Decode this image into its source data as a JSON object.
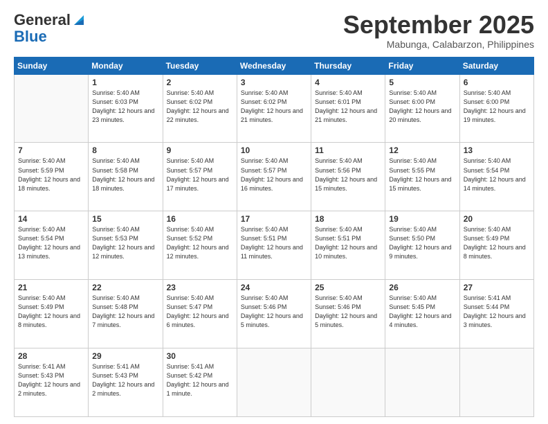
{
  "header": {
    "logo_general": "General",
    "logo_blue": "Blue",
    "month_title": "September 2025",
    "location": "Mabunga, Calabarzon, Philippines"
  },
  "days": [
    "Sunday",
    "Monday",
    "Tuesday",
    "Wednesday",
    "Thursday",
    "Friday",
    "Saturday"
  ],
  "weeks": [
    [
      {
        "day": "",
        "sunrise": "",
        "sunset": "",
        "daylight": ""
      },
      {
        "day": "1",
        "sunrise": "Sunrise: 5:40 AM",
        "sunset": "Sunset: 6:03 PM",
        "daylight": "Daylight: 12 hours and 23 minutes."
      },
      {
        "day": "2",
        "sunrise": "Sunrise: 5:40 AM",
        "sunset": "Sunset: 6:02 PM",
        "daylight": "Daylight: 12 hours and 22 minutes."
      },
      {
        "day": "3",
        "sunrise": "Sunrise: 5:40 AM",
        "sunset": "Sunset: 6:02 PM",
        "daylight": "Daylight: 12 hours and 21 minutes."
      },
      {
        "day": "4",
        "sunrise": "Sunrise: 5:40 AM",
        "sunset": "Sunset: 6:01 PM",
        "daylight": "Daylight: 12 hours and 21 minutes."
      },
      {
        "day": "5",
        "sunrise": "Sunrise: 5:40 AM",
        "sunset": "Sunset: 6:00 PM",
        "daylight": "Daylight: 12 hours and 20 minutes."
      },
      {
        "day": "6",
        "sunrise": "Sunrise: 5:40 AM",
        "sunset": "Sunset: 6:00 PM",
        "daylight": "Daylight: 12 hours and 19 minutes."
      }
    ],
    [
      {
        "day": "7",
        "sunrise": "Sunrise: 5:40 AM",
        "sunset": "Sunset: 5:59 PM",
        "daylight": "Daylight: 12 hours and 18 minutes."
      },
      {
        "day": "8",
        "sunrise": "Sunrise: 5:40 AM",
        "sunset": "Sunset: 5:58 PM",
        "daylight": "Daylight: 12 hours and 18 minutes."
      },
      {
        "day": "9",
        "sunrise": "Sunrise: 5:40 AM",
        "sunset": "Sunset: 5:57 PM",
        "daylight": "Daylight: 12 hours and 17 minutes."
      },
      {
        "day": "10",
        "sunrise": "Sunrise: 5:40 AM",
        "sunset": "Sunset: 5:57 PM",
        "daylight": "Daylight: 12 hours and 16 minutes."
      },
      {
        "day": "11",
        "sunrise": "Sunrise: 5:40 AM",
        "sunset": "Sunset: 5:56 PM",
        "daylight": "Daylight: 12 hours and 15 minutes."
      },
      {
        "day": "12",
        "sunrise": "Sunrise: 5:40 AM",
        "sunset": "Sunset: 5:55 PM",
        "daylight": "Daylight: 12 hours and 15 minutes."
      },
      {
        "day": "13",
        "sunrise": "Sunrise: 5:40 AM",
        "sunset": "Sunset: 5:54 PM",
        "daylight": "Daylight: 12 hours and 14 minutes."
      }
    ],
    [
      {
        "day": "14",
        "sunrise": "Sunrise: 5:40 AM",
        "sunset": "Sunset: 5:54 PM",
        "daylight": "Daylight: 12 hours and 13 minutes."
      },
      {
        "day": "15",
        "sunrise": "Sunrise: 5:40 AM",
        "sunset": "Sunset: 5:53 PM",
        "daylight": "Daylight: 12 hours and 12 minutes."
      },
      {
        "day": "16",
        "sunrise": "Sunrise: 5:40 AM",
        "sunset": "Sunset: 5:52 PM",
        "daylight": "Daylight: 12 hours and 12 minutes."
      },
      {
        "day": "17",
        "sunrise": "Sunrise: 5:40 AM",
        "sunset": "Sunset: 5:51 PM",
        "daylight": "Daylight: 12 hours and 11 minutes."
      },
      {
        "day": "18",
        "sunrise": "Sunrise: 5:40 AM",
        "sunset": "Sunset: 5:51 PM",
        "daylight": "Daylight: 12 hours and 10 minutes."
      },
      {
        "day": "19",
        "sunrise": "Sunrise: 5:40 AM",
        "sunset": "Sunset: 5:50 PM",
        "daylight": "Daylight: 12 hours and 9 minutes."
      },
      {
        "day": "20",
        "sunrise": "Sunrise: 5:40 AM",
        "sunset": "Sunset: 5:49 PM",
        "daylight": "Daylight: 12 hours and 8 minutes."
      }
    ],
    [
      {
        "day": "21",
        "sunrise": "Sunrise: 5:40 AM",
        "sunset": "Sunset: 5:49 PM",
        "daylight": "Daylight: 12 hours and 8 minutes."
      },
      {
        "day": "22",
        "sunrise": "Sunrise: 5:40 AM",
        "sunset": "Sunset: 5:48 PM",
        "daylight": "Daylight: 12 hours and 7 minutes."
      },
      {
        "day": "23",
        "sunrise": "Sunrise: 5:40 AM",
        "sunset": "Sunset: 5:47 PM",
        "daylight": "Daylight: 12 hours and 6 minutes."
      },
      {
        "day": "24",
        "sunrise": "Sunrise: 5:40 AM",
        "sunset": "Sunset: 5:46 PM",
        "daylight": "Daylight: 12 hours and 5 minutes."
      },
      {
        "day": "25",
        "sunrise": "Sunrise: 5:40 AM",
        "sunset": "Sunset: 5:46 PM",
        "daylight": "Daylight: 12 hours and 5 minutes."
      },
      {
        "day": "26",
        "sunrise": "Sunrise: 5:40 AM",
        "sunset": "Sunset: 5:45 PM",
        "daylight": "Daylight: 12 hours and 4 minutes."
      },
      {
        "day": "27",
        "sunrise": "Sunrise: 5:41 AM",
        "sunset": "Sunset: 5:44 PM",
        "daylight": "Daylight: 12 hours and 3 minutes."
      }
    ],
    [
      {
        "day": "28",
        "sunrise": "Sunrise: 5:41 AM",
        "sunset": "Sunset: 5:43 PM",
        "daylight": "Daylight: 12 hours and 2 minutes."
      },
      {
        "day": "29",
        "sunrise": "Sunrise: 5:41 AM",
        "sunset": "Sunset: 5:43 PM",
        "daylight": "Daylight: 12 hours and 2 minutes."
      },
      {
        "day": "30",
        "sunrise": "Sunrise: 5:41 AM",
        "sunset": "Sunset: 5:42 PM",
        "daylight": "Daylight: 12 hours and 1 minute."
      },
      {
        "day": "",
        "sunrise": "",
        "sunset": "",
        "daylight": ""
      },
      {
        "day": "",
        "sunrise": "",
        "sunset": "",
        "daylight": ""
      },
      {
        "day": "",
        "sunrise": "",
        "sunset": "",
        "daylight": ""
      },
      {
        "day": "",
        "sunrise": "",
        "sunset": "",
        "daylight": ""
      }
    ]
  ]
}
